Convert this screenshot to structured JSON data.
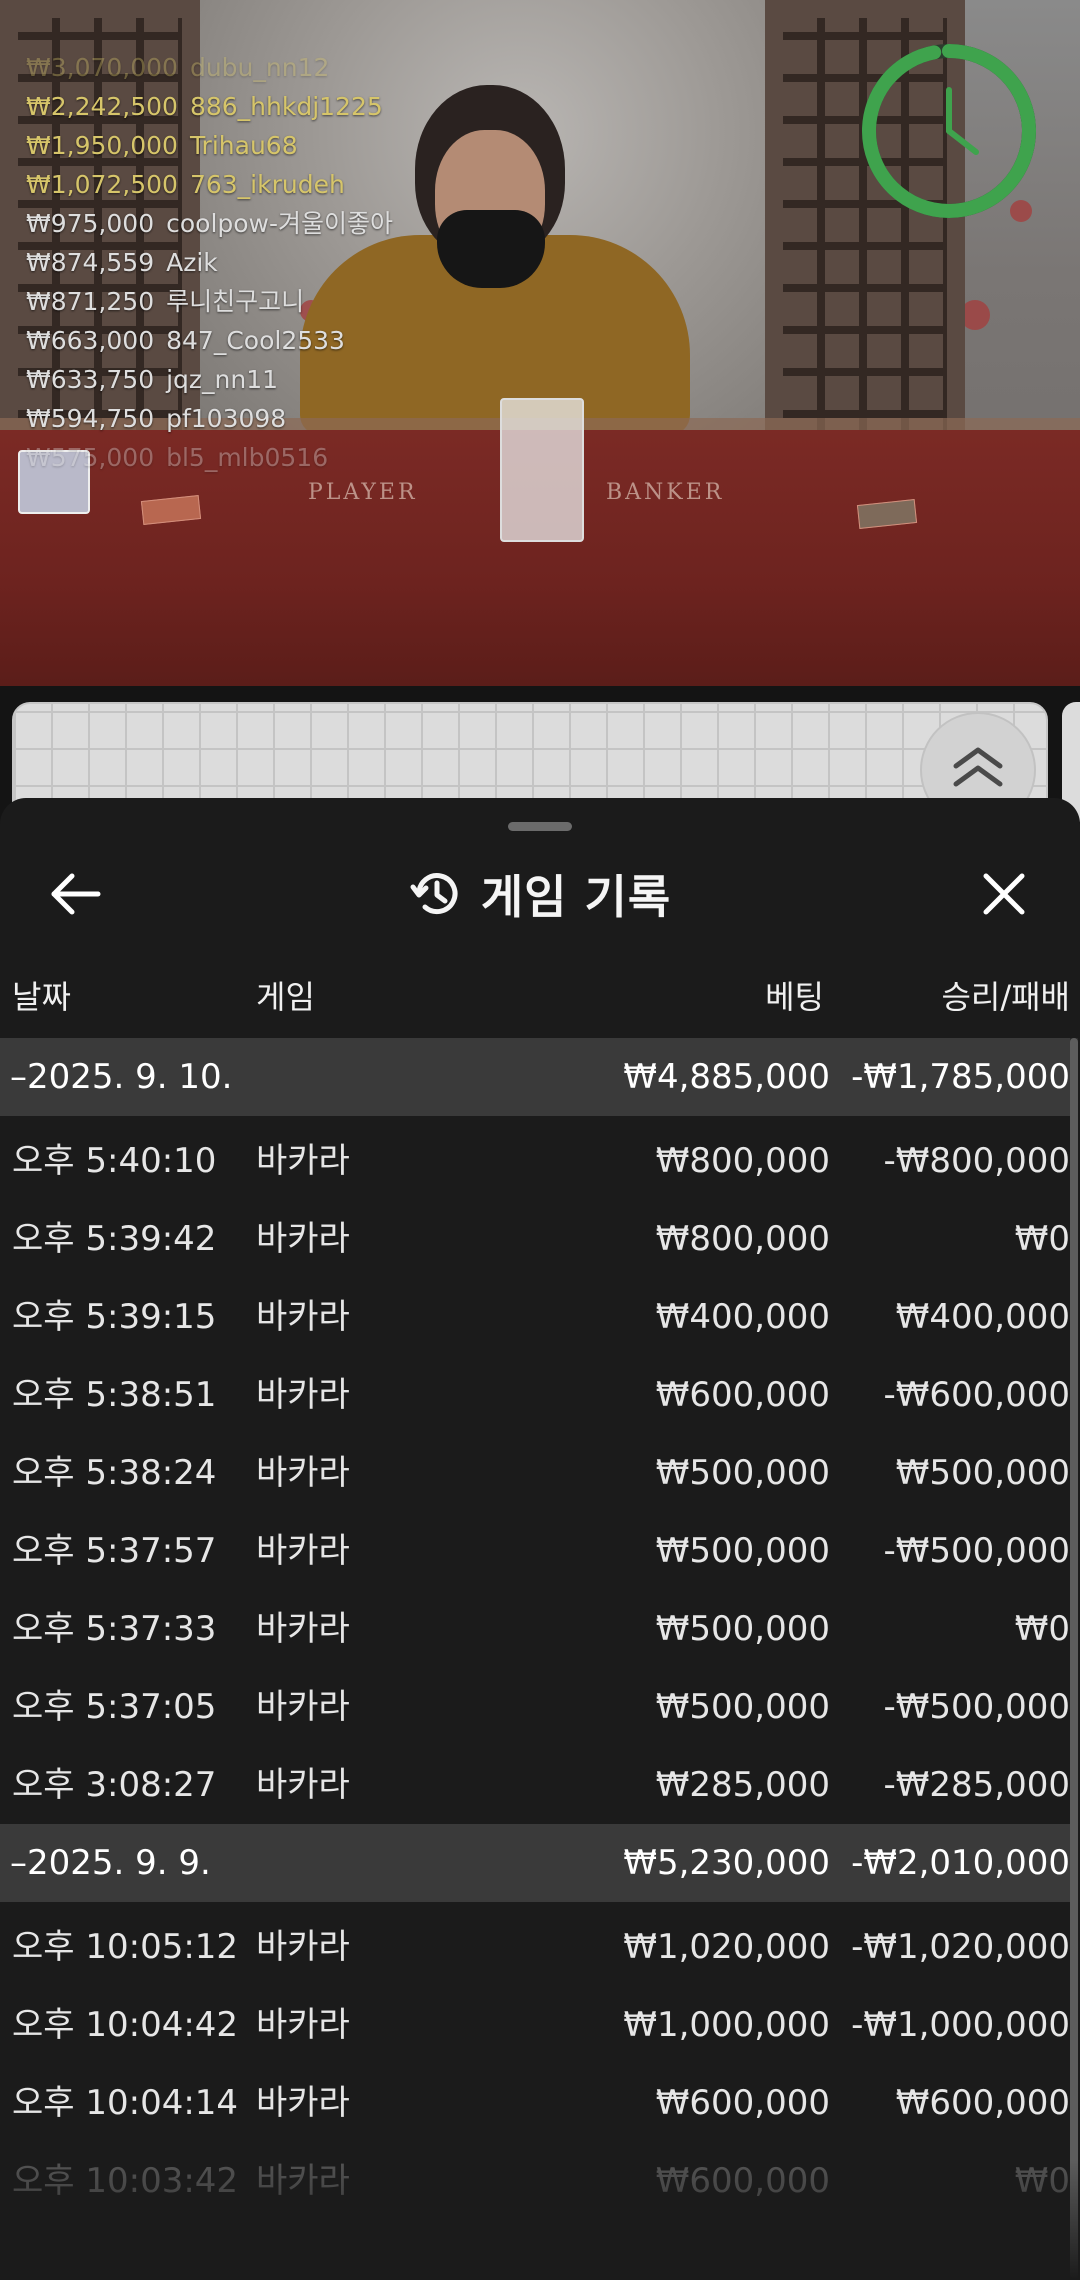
{
  "leaderboard": [
    {
      "amount": "₩3,070,000",
      "user": "dubu_nn12",
      "tier": "top",
      "faded": true
    },
    {
      "amount": "₩2,242,500",
      "user": "886_hhkdj1225",
      "tier": "top",
      "faded": false
    },
    {
      "amount": "₩1,950,000",
      "user": "Trihau68",
      "tier": "top",
      "faded": false
    },
    {
      "amount": "₩1,072,500",
      "user": "763_ikrudeh",
      "tier": "top",
      "faded": false
    },
    {
      "amount": "₩975,000",
      "user": "coolpow-겨울이좋아",
      "tier": "reg",
      "faded": false
    },
    {
      "amount": "₩874,559",
      "user": "Azik",
      "tier": "reg",
      "faded": false
    },
    {
      "amount": "₩871,250",
      "user": "루니친구고니",
      "tier": "reg",
      "faded": false
    },
    {
      "amount": "₩663,000",
      "user": "847_Cool2533",
      "tier": "reg",
      "faded": false
    },
    {
      "amount": "₩633,750",
      "user": "jqz_nn11",
      "tier": "reg",
      "faded": false
    },
    {
      "amount": "₩594,750",
      "user": "pf103098",
      "tier": "reg",
      "faded": false
    },
    {
      "amount": "₩575,000",
      "user": "bl5_mlb0516",
      "tier": "reg",
      "faded": true
    }
  ],
  "table_labels": {
    "player": "PLAYER",
    "banker": "BANKER"
  },
  "timer": {
    "remaining_fraction": 0.97,
    "color": "#3fa34d"
  },
  "sheet": {
    "title": "게임 기록",
    "columns": {
      "date": "날짜",
      "game": "게임",
      "bet": "베팅",
      "result": "승리/패배"
    },
    "groups": [
      {
        "date": "–2025. 9. 10.",
        "total_bet": "₩4,885,000",
        "total_result": "-₩1,785,000",
        "rows": [
          {
            "time": "오후 5:40:10",
            "game": "바카라",
            "bet": "₩800,000",
            "result": "-₩800,000"
          },
          {
            "time": "오후 5:39:42",
            "game": "바카라",
            "bet": "₩800,000",
            "result": "₩0"
          },
          {
            "time": "오후 5:39:15",
            "game": "바카라",
            "bet": "₩400,000",
            "result": "₩400,000"
          },
          {
            "time": "오후 5:38:51",
            "game": "바카라",
            "bet": "₩600,000",
            "result": "-₩600,000"
          },
          {
            "time": "오후 5:38:24",
            "game": "바카라",
            "bet": "₩500,000",
            "result": "₩500,000"
          },
          {
            "time": "오후 5:37:57",
            "game": "바카라",
            "bet": "₩500,000",
            "result": "-₩500,000"
          },
          {
            "time": "오후 5:37:33",
            "game": "바카라",
            "bet": "₩500,000",
            "result": "₩0"
          },
          {
            "time": "오후 5:37:05",
            "game": "바카라",
            "bet": "₩500,000",
            "result": "-₩500,000"
          },
          {
            "time": "오후 3:08:27",
            "game": "바카라",
            "bet": "₩285,000",
            "result": "-₩285,000"
          }
        ]
      },
      {
        "date": "–2025. 9. 9.",
        "total_bet": "₩5,230,000",
        "total_result": "-₩2,010,000",
        "rows": [
          {
            "time": "오후 10:05:12",
            "game": "바카라",
            "bet": "₩1,020,000",
            "result": "-₩1,020,000"
          },
          {
            "time": "오후 10:04:42",
            "game": "바카라",
            "bet": "₩1,000,000",
            "result": "-₩1,000,000"
          },
          {
            "time": "오후 10:04:14",
            "game": "바카라",
            "bet": "₩600,000",
            "result": "₩600,000"
          },
          {
            "time": "오후 10:03:42",
            "game": "바카라",
            "bet": "₩600,000",
            "result": "₩0",
            "faded": true
          }
        ]
      }
    ]
  },
  "icons": {
    "back": "arrow-left-icon",
    "history": "history-clock-icon",
    "close": "close-x-icon",
    "collapse": "double-chevron-up-icon",
    "timer": "timer-ring-icon"
  }
}
